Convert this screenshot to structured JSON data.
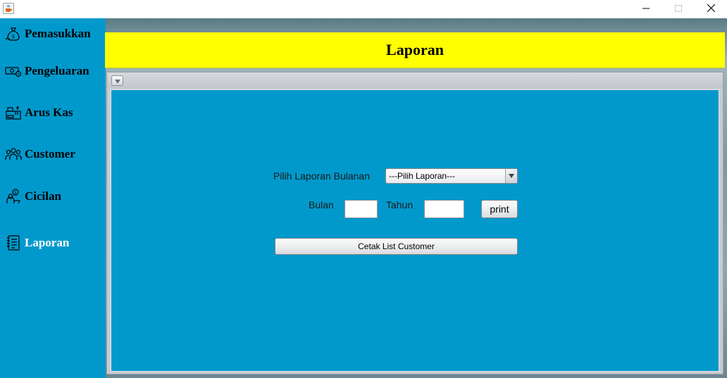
{
  "window": {
    "icon": "java-cup-icon",
    "controls": {
      "minimize": "minimize-icon",
      "maximize": "maximize-icon",
      "close": "close-icon"
    }
  },
  "sidebar": {
    "items": [
      {
        "label": "Pemasukkan",
        "icon": "money-bag-icon"
      },
      {
        "label": "Pengeluaran",
        "icon": "cash-icon"
      },
      {
        "label": "Arus Kas",
        "icon": "cash-register-icon"
      },
      {
        "label": "Customer",
        "icon": "people-icon"
      },
      {
        "label": "Cicilan",
        "icon": "installment-icon"
      },
      {
        "label": "Laporan",
        "icon": "report-icon",
        "active": true
      }
    ]
  },
  "header": {
    "title": "Laporan"
  },
  "report": {
    "monthly_label": "Pilih Laporan Bulanan",
    "monthly_select_value": "---Pilih Laporan---",
    "bulan_label": "Bulan",
    "bulan_value": "",
    "tahun_label": "Tahun",
    "tahun_value": "",
    "print_label": "print",
    "customer_list_label": "Cetak List Customer"
  },
  "colors": {
    "sidebar": "#0199cc",
    "header": "#ffff00",
    "content": "#0199cc"
  }
}
